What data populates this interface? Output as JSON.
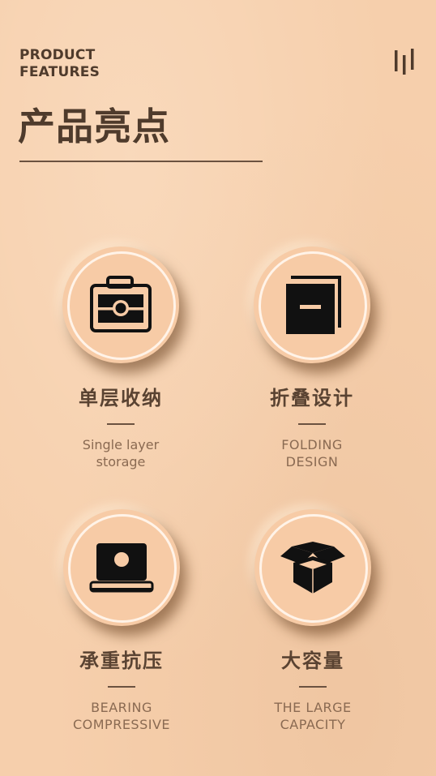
{
  "header": {
    "eyebrow_line1": "PRODUCT",
    "eyebrow_line2": "FEATURES",
    "title": "产品亮点",
    "menu_icon": "bars-icon"
  },
  "features": [
    {
      "title": "单层收纳",
      "subtitle_line1": "Single layer",
      "subtitle_line2": "storage",
      "icon": "briefcase-icon"
    },
    {
      "title": "折叠设计",
      "subtitle_line1": "FOLDING",
      "subtitle_line2": "DESIGN",
      "icon": "folded-pages-icon"
    },
    {
      "title": "承重抗压",
      "subtitle_line1": "BEARING",
      "subtitle_line2": "COMPRESSIVE",
      "icon": "laptop-icon"
    },
    {
      "title": "大容量",
      "subtitle_line1": "THE LARGE",
      "subtitle_line2": "CAPACITY",
      "icon": "open-box-icon"
    }
  ],
  "colors": {
    "background": "#f6cfac",
    "medallion": "#f7cba6",
    "text_dark": "#4f3b2c",
    "text_muted": "#8a6a52",
    "icon": "#111111"
  }
}
